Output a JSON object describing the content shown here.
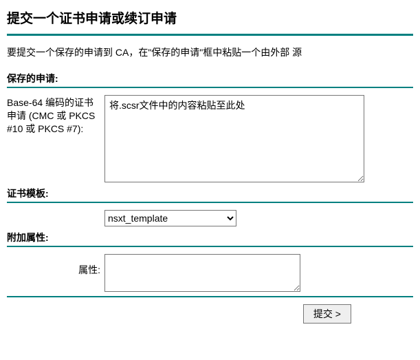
{
  "page_title": "提交一个证书申请或续订申请",
  "intro_text": "要提交一个保存的申请到 CA，在\"保存的申请\"框中粘贴一个由外部 源",
  "sections": {
    "saved_request": {
      "heading": "保存的申请:",
      "field_label": "Base-64 编码的证书申请\n(CMC 或 PKCS #10 或 PKCS #7):",
      "textarea_value": "将.scsr文件中的内容粘贴至此处"
    },
    "cert_template": {
      "heading": "证书模板:",
      "selected": "nsxt_template",
      "options": [
        "nsxt_template"
      ]
    },
    "additional_attrs": {
      "heading": "附加属性:",
      "field_label": "属性:",
      "textarea_value": ""
    }
  },
  "submit_label": "提交 >"
}
